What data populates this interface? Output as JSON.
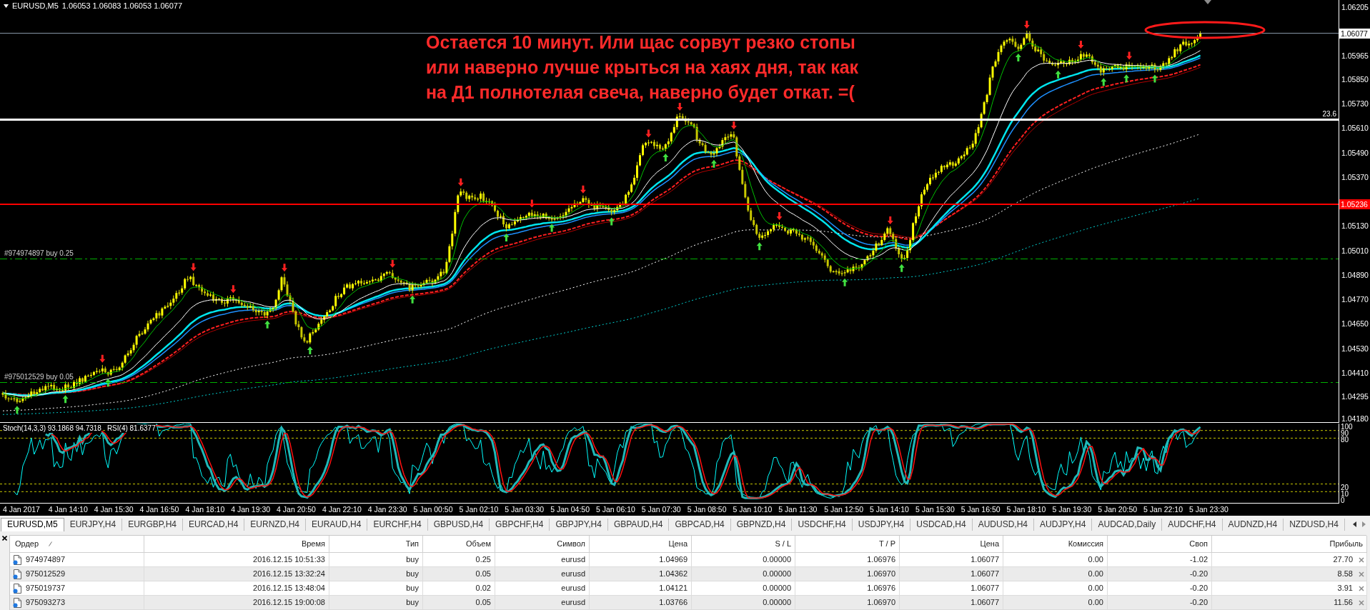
{
  "chart": {
    "symbol": "EURUSD,M5",
    "quotes": "1.06053 1.06083 1.06053 1.06077",
    "annotation": "Остается 10 минут. Или щас сорвут резко стопы\nили наверно лучше крыться на хаях дня, так как\nна Д1 полнотелая свеча, наверно будет откат. =(",
    "levels": [
      {
        "kind": "bid",
        "label": "1.06077"
      },
      {
        "kind": "fibo",
        "label": "23.6"
      },
      {
        "kind": "alert",
        "label": "1.05236"
      },
      {
        "kind": "order",
        "label": "#974974897 buy 0.25"
      },
      {
        "kind": "order",
        "label": "#975012529 buy 0.05"
      }
    ],
    "price_axis": [
      "1.06205",
      "1.05965",
      "1.05850",
      "1.05730",
      "1.05610",
      "1.05490",
      "1.05370",
      "1.05130",
      "1.05010",
      "1.04890",
      "1.04770",
      "1.04650",
      "1.04530",
      "1.04410",
      "1.04295",
      "1.04180"
    ]
  },
  "indicator": {
    "labels": [
      "Stoch(14,3,3) 93.1868 94.7318",
      "RSI(4) 81.6377"
    ],
    "scale": [
      "100",
      "90",
      "80",
      "20",
      "10",
      "0"
    ]
  },
  "time_axis": [
    "4 Jan 2017",
    "4 Jan 14:10",
    "4 Jan 15:30",
    "4 Jan 16:50",
    "4 Jan 18:10",
    "4 Jan 19:30",
    "4 Jan 20:50",
    "4 Jan 22:10",
    "4 Jan 23:30",
    "5 Jan 00:50",
    "5 Jan 02:10",
    "5 Jan 03:30",
    "5 Jan 04:50",
    "5 Jan 06:10",
    "5 Jan 07:30",
    "5 Jan 08:50",
    "5 Jan 10:10",
    "5 Jan 11:30",
    "5 Jan 12:50",
    "5 Jan 14:10",
    "5 Jan 15:30",
    "5 Jan 16:50",
    "5 Jan 18:10",
    "5 Jan 19:30",
    "5 Jan 20:50",
    "5 Jan 22:10",
    "5 Jan 23:30"
  ],
  "tabs": [
    {
      "label": "EURUSD,M5",
      "selected": true
    },
    {
      "label": "EURJPY,H4",
      "selected": false
    },
    {
      "label": "EURGBP,H4",
      "selected": false
    },
    {
      "label": "EURCAD,H4",
      "selected": false
    },
    {
      "label": "EURNZD,H4",
      "selected": false
    },
    {
      "label": "EURAUD,H4",
      "selected": false
    },
    {
      "label": "EURCHF,H4",
      "selected": false
    },
    {
      "label": "GBPUSD,H4",
      "selected": false
    },
    {
      "label": "GBPCHF,H4",
      "selected": false
    },
    {
      "label": "GBPJPY,H4",
      "selected": false
    },
    {
      "label": "GBPAUD,H4",
      "selected": false
    },
    {
      "label": "GBPCAD,H4",
      "selected": false
    },
    {
      "label": "GBPNZD,H4",
      "selected": false
    },
    {
      "label": "USDCHF,H4",
      "selected": false
    },
    {
      "label": "USDJPY,H4",
      "selected": false
    },
    {
      "label": "USDCAD,H4",
      "selected": false
    },
    {
      "label": "AUDUSD,H4",
      "selected": false
    },
    {
      "label": "AUDJPY,H4",
      "selected": false
    },
    {
      "label": "AUDCAD,Daily",
      "selected": false
    },
    {
      "label": "AUDCHF,H4",
      "selected": false
    },
    {
      "label": "AUDNZD,H4",
      "selected": false
    },
    {
      "label": "NZDUSD,H4",
      "selected": false
    }
  ],
  "orders": {
    "columns": [
      {
        "label": "Ордер",
        "sorted": true
      },
      {
        "label": "Время",
        "sorted": false
      },
      {
        "label": "Тип",
        "sorted": false
      },
      {
        "label": "Объем",
        "sorted": false
      },
      {
        "label": "Символ",
        "sorted": false
      },
      {
        "label": "Цена",
        "sorted": false
      },
      {
        "label": "S / L",
        "sorted": false
      },
      {
        "label": "T / P",
        "sorted": false
      },
      {
        "label": "Цена",
        "sorted": false
      },
      {
        "label": "Комиссия",
        "sorted": false
      },
      {
        "label": "Своп",
        "sorted": false
      },
      {
        "label": "Прибыль",
        "sorted": false
      }
    ],
    "rows": [
      [
        "974974897",
        "2016.12.15 10:51:33",
        "buy",
        "0.25",
        "eurusd",
        "1.04969",
        "0.00000",
        "1.06976",
        "1.06077",
        "0.00",
        "-1.02",
        "27.70"
      ],
      [
        "975012529",
        "2016.12.15 13:32:24",
        "buy",
        "0.05",
        "eurusd",
        "1.04362",
        "0.00000",
        "1.06970",
        "1.06077",
        "0.00",
        "-0.20",
        "8.58"
      ],
      [
        "975019737",
        "2016.12.15 13:48:04",
        "buy",
        "0.02",
        "eurusd",
        "1.04121",
        "0.00000",
        "1.06976",
        "1.06077",
        "0.00",
        "-0.20",
        "3.91"
      ],
      [
        "975093273",
        "2016.12.15 19:00:08",
        "buy",
        "0.05",
        "eurusd",
        "1.03766",
        "0.00000",
        "1.06970",
        "1.06077",
        "0.00",
        "-0.20",
        "11.56"
      ]
    ]
  }
}
